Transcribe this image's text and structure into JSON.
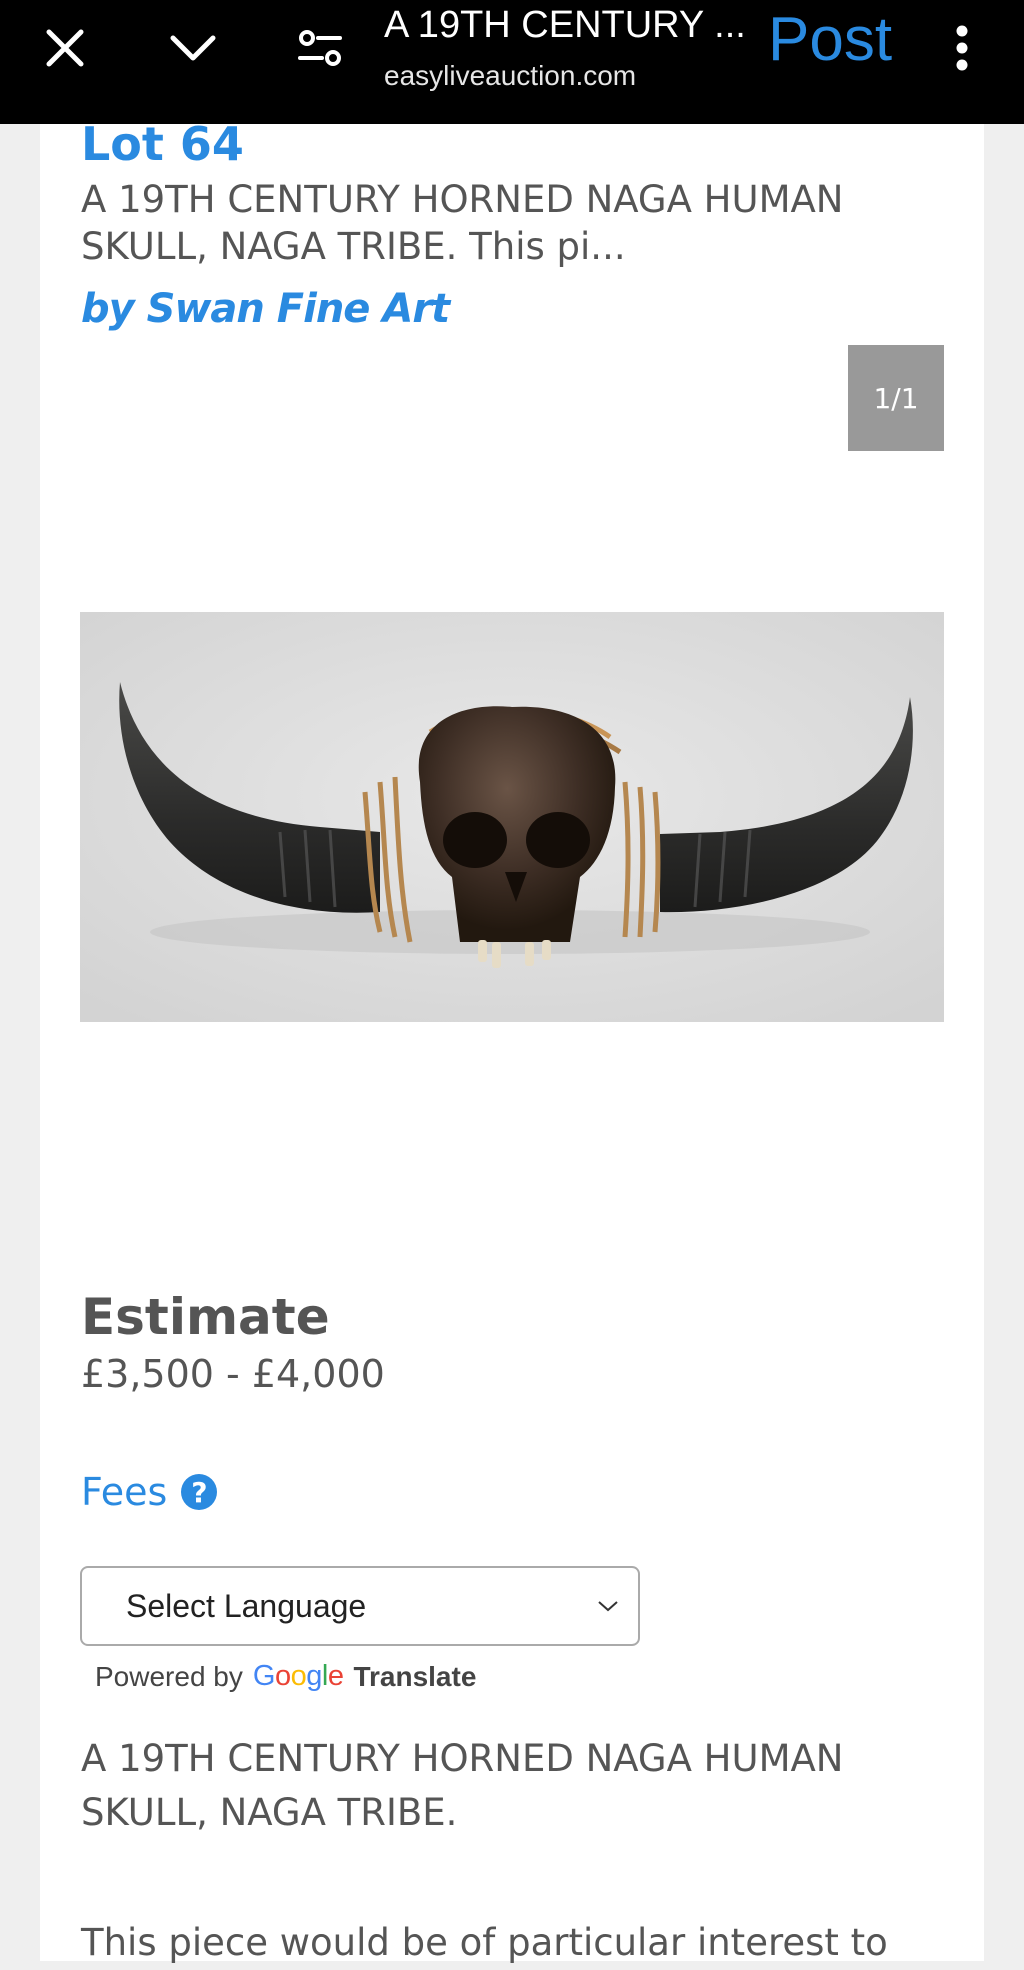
{
  "browser": {
    "page_title": "A 19TH CENTURY ...",
    "url": "easyliveauction.com",
    "post_label": "Post"
  },
  "lot": {
    "title": "Lot 64",
    "summary": "A 19TH CENTURY HORNED NAGA HUMAN SKULL, NAGA TRIBE. This pi...",
    "seller": "by Swan Fine Art",
    "image_counter": "1/1"
  },
  "estimate": {
    "label": "Estimate",
    "value": "£3,500 - £4,000"
  },
  "fees": {
    "label": "Fees",
    "help_glyph": "?"
  },
  "translate": {
    "select_value": "Select Language",
    "powered_by": "Powered by",
    "google": "Google",
    "translate_word": "Translate"
  },
  "description": {
    "paragraph1": "A 19TH CENTURY HORNED NAGA HUMAN SKULL, NAGA TRIBE.",
    "paragraph2": "This piece would be of particular interest to"
  },
  "colors": {
    "accent": "#2a8ae0",
    "topbar": "#000000",
    "text": "#555555"
  }
}
